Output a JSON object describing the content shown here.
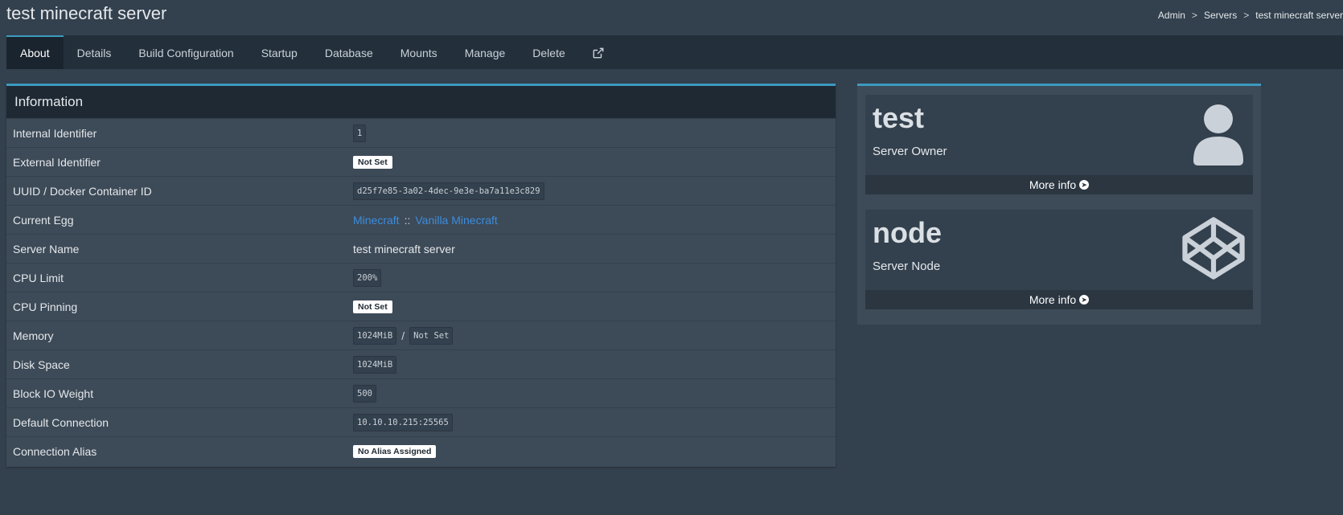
{
  "header": {
    "title": "test minecraft server",
    "breadcrumb": [
      "Admin",
      "Servers",
      "test minecraft server"
    ],
    "breadcrumb_sep": ">"
  },
  "tabs": [
    {
      "label": "About",
      "active": true
    },
    {
      "label": "Details"
    },
    {
      "label": "Build Configuration"
    },
    {
      "label": "Startup"
    },
    {
      "label": "Database"
    },
    {
      "label": "Mounts"
    },
    {
      "label": "Manage"
    },
    {
      "label": "Delete"
    },
    {
      "label": "",
      "icon": "external-link-icon"
    }
  ],
  "info": {
    "title": "Information",
    "rows": {
      "internal_id": {
        "label": "Internal Identifier",
        "value": "1"
      },
      "external_id": {
        "label": "External Identifier",
        "value": "Not Set"
      },
      "uuid": {
        "label": "UUID / Docker Container ID",
        "value": "d25f7e85-3a02-4dec-9e3e-ba7a11e3c829"
      },
      "egg": {
        "label": "Current Egg",
        "nest": "Minecraft",
        "separator": "::",
        "egg": "Vanilla Minecraft"
      },
      "server_name": {
        "label": "Server Name",
        "value": "test minecraft server"
      },
      "cpu_limit": {
        "label": "CPU Limit",
        "value": "200%"
      },
      "cpu_pinning": {
        "label": "CPU Pinning",
        "value": "Not Set"
      },
      "memory": {
        "label": "Memory",
        "value": "1024MiB",
        "separator": "/",
        "swap": "Not Set"
      },
      "disk": {
        "label": "Disk Space",
        "value": "1024MiB"
      },
      "block_io": {
        "label": "Block IO Weight",
        "value": "500"
      },
      "default_conn": {
        "label": "Default Connection",
        "value": "10.10.10.215:25565"
      },
      "conn_alias": {
        "label": "Connection Alias",
        "value": "No Alias Assigned"
      }
    }
  },
  "owner_box": {
    "name": "test",
    "caption": "Server Owner",
    "footer": "More info",
    "icon": "user-icon"
  },
  "node_box": {
    "name": "node",
    "caption": "Server Node",
    "footer": "More info",
    "icon": "codepen-icon"
  },
  "colors": {
    "accent": "#3c9bbf",
    "link": "#3c8dde",
    "background": "#33404d"
  }
}
